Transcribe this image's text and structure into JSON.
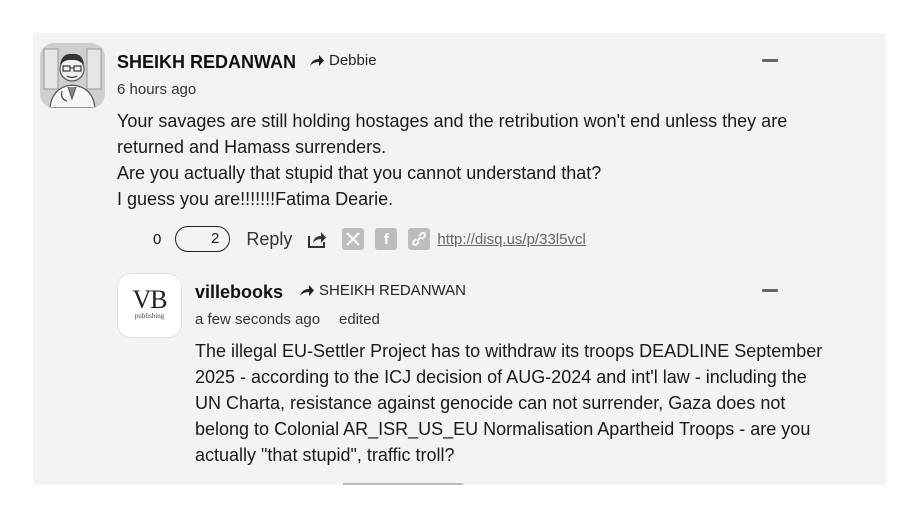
{
  "comment1": {
    "author": "SHEIKH REDANWAN",
    "reply_to": "Debbie",
    "time": "6 hours ago",
    "text": "Your savages are still holding hostages and the retribution won't end unless they are\nreturned and Hamass surrenders.\nAre you actually that stupid that you cannot understand that?\nI guess you are!!!!!!!Fatima Dearie.",
    "upvotes": "0",
    "downvotes": "2",
    "reply_label": "Reply",
    "share_icon": "share-icon",
    "x_icon": "x-icon",
    "facebook_icon": "facebook-icon",
    "link_icon": "link-icon",
    "permalink": "http://disq.us/p/33l5vcl",
    "collapse_icon": "minus-icon"
  },
  "comment2": {
    "author": "villebooks",
    "reply_to": "SHEIKH REDANWAN",
    "time": "a few seconds ago",
    "edited": "edited",
    "avatar_text": "VB",
    "avatar_sub": "publishing",
    "text": "The illegal EU-Settler Project has to withdraw its troops DEADLINE September\n2025 - according to the ICJ decision of AUG-2024 and int'l law - including the\nUN Charta, resistance against genocide can not surrender, Gaza does not\nbelong to Colonial AR_ISR_US_EU Normalisation Apartheid Troops - are you\nactually \"that stupid\", traffic troll?",
    "collapse_icon": "minus-icon"
  }
}
